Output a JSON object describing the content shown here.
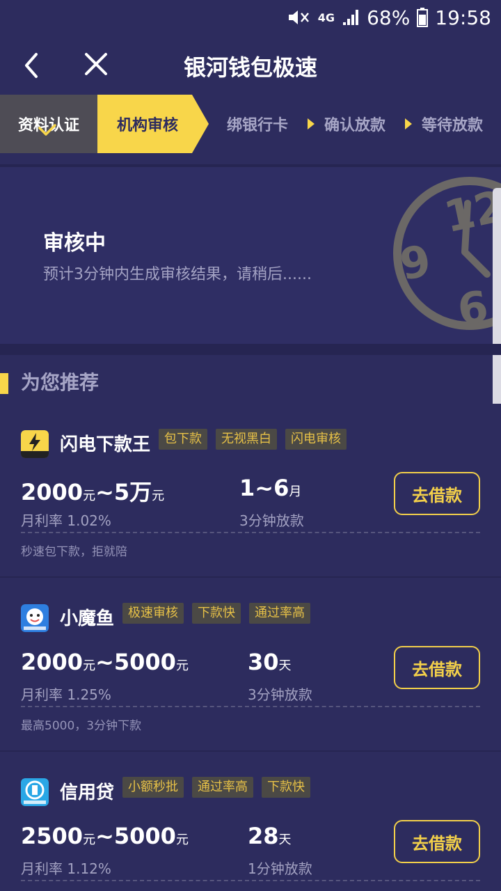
{
  "statusbar": {
    "network": "4G",
    "battery": "68%",
    "time": "19:58"
  },
  "header": {
    "title": "银河钱包极速"
  },
  "steps": [
    {
      "label": "资料认证",
      "state": "done"
    },
    {
      "label": "机构审核",
      "state": "active"
    },
    {
      "label": "绑银行卡",
      "state": "pending"
    },
    {
      "label": "确认放款",
      "state": "pending"
    },
    {
      "label": "等待放款",
      "state": "pending"
    }
  ],
  "status": {
    "title": "审核中",
    "subtitle": "预计3分钟内生成审核结果，请稍后......",
    "clock_digits": [
      "12",
      "9",
      "6"
    ]
  },
  "recommend": {
    "title": "为您推荐"
  },
  "products": [
    {
      "name": "闪电下款王",
      "logo_label": "下款王",
      "tags": [
        "包下款",
        "无视黑白",
        "闪电审核"
      ],
      "amount_min": "2000",
      "amount_min_unit": "元",
      "amount_sep": "~",
      "amount_max": "5万",
      "amount_max_unit": "元",
      "rate": "月利率 1.02%",
      "term": "1~6",
      "term_unit": "月",
      "speed": "3分钟放款",
      "button": "去借款",
      "note": "秒速包下款，拒就陪"
    },
    {
      "name": "小魔鱼",
      "logo_label": "小魔鱼",
      "tags": [
        "极速审核",
        "下款快",
        "通过率高"
      ],
      "amount_min": "2000",
      "amount_min_unit": "元",
      "amount_sep": "~",
      "amount_max": "5000",
      "amount_max_unit": "元",
      "rate": "月利率 1.25%",
      "term": "30",
      "term_unit": "天",
      "speed": "3分钟放款",
      "button": "去借款",
      "note": "最高5000，3分钟下款"
    },
    {
      "name": "信用贷",
      "logo_label": "信用贷",
      "tags": [
        "小额秒批",
        "通过率高",
        "下款快"
      ],
      "amount_min": "2500",
      "amount_min_unit": "元",
      "amount_sep": "~",
      "amount_max": "5000",
      "amount_max_unit": "元",
      "rate": "月利率 1.12%",
      "term": "28",
      "term_unit": "天",
      "speed": "1分钟放款",
      "button": "去借款",
      "note": ""
    }
  ],
  "colors": {
    "background": "#2d2c5e",
    "accent": "#f8d64a",
    "tag_text": "#e7c147"
  }
}
